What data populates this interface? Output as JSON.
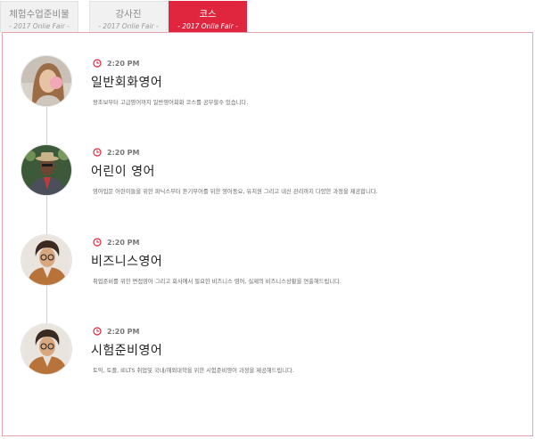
{
  "tabs": [
    {
      "title": "체험수업준비물",
      "subtitle": "- 2017 Onlie Fair -",
      "active": false
    },
    {
      "title": "강사진",
      "subtitle": "- 2017 Onlie Fair -",
      "active": false
    },
    {
      "title": "코스",
      "subtitle": "- 2017 Onlie Fair -",
      "active": true
    }
  ],
  "colors": {
    "accent": "#e0263f",
    "panel_border": "#e8a3ad"
  },
  "courses": [
    {
      "time": "2:20 PM",
      "title": "일반회화영어",
      "description": "왕초보부터 고급영어까지 일반영어회화 코스를 공부할수 있습니다.",
      "avatar": "woman-blowing-bubblegum"
    },
    {
      "time": "2:20 PM",
      "title": "어린이 영어",
      "description": "영어입문 어린이들을 위한 파닉스부터 듣기부어를 위한 영어동요, 유치원 그리고 내신 관리까지 다양한 과정을 제공합니다.",
      "avatar": "man-in-suit-hat"
    },
    {
      "time": "2:20 PM",
      "title": "비즈니스영어",
      "description": "취업준비를 위한 면접영어 그리고 회사에서 필요한 비즈니스 영어, 실제의 비즈니스상황을 연출해드립니다.",
      "avatar": "man-curly-hair-glasses"
    },
    {
      "time": "2:20 PM",
      "title": "시험준비영어",
      "description": "토익, 토플, IELTS 취업및 국내/해외대학을 위한 시험준비영어 과정을 제공해드립니다.",
      "avatar": "man-curly-hair-glasses"
    }
  ]
}
